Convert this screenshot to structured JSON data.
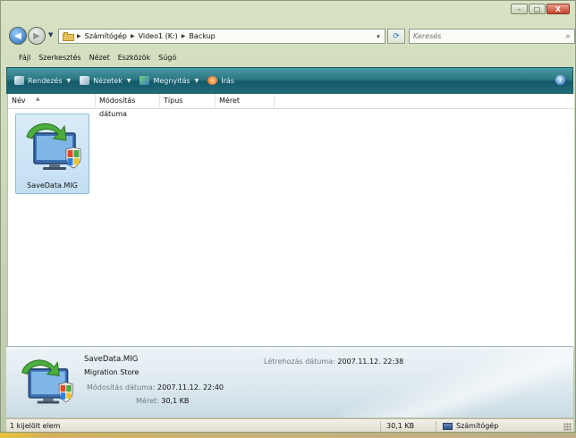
{
  "window": {
    "minimize_glyph": "–",
    "maximize_glyph": "□",
    "close_glyph": "X"
  },
  "address": {
    "folder_icon": "folder-icon",
    "breadcrumbs": [
      "Számítógép",
      "Video1 (K:)",
      "Backup"
    ],
    "dropdown_glyph": "▾",
    "refresh_glyph": "⟳"
  },
  "search": {
    "placeholder": "Keresés",
    "icon": "magnifier-icon"
  },
  "menu": [
    "Fájl",
    "Szerkesztés",
    "Nézet",
    "Eszközök",
    "Súgó"
  ],
  "toolbar": {
    "organize": "Rendezés",
    "views": "Nézetek",
    "open": "Megnyitás",
    "burn": "Írás",
    "help_glyph": "?"
  },
  "columns": [
    "Név",
    "Módosítás dátuma",
    "Típus",
    "Méret"
  ],
  "files": [
    {
      "name": "SaveData.MIG",
      "icon": "migration-store-icon"
    }
  ],
  "details": {
    "name": "SaveData.MIG",
    "type": "Migration Store",
    "modified_label": "Módosítás dátuma:",
    "modified_value": "2007.11.12. 22:40",
    "size_label": "Méret:",
    "size_value": "30,1 KB",
    "created_label": "Létrehozás dátuma:",
    "created_value": "2007.11.12. 22:38"
  },
  "status": {
    "selected": "1 kijelölt elem",
    "size": "30,1 KB",
    "location": "Számítógép"
  },
  "colors": {
    "toolbar": "#1f6b78",
    "selection": "#c3def2",
    "frame": "#c7d3b4"
  }
}
